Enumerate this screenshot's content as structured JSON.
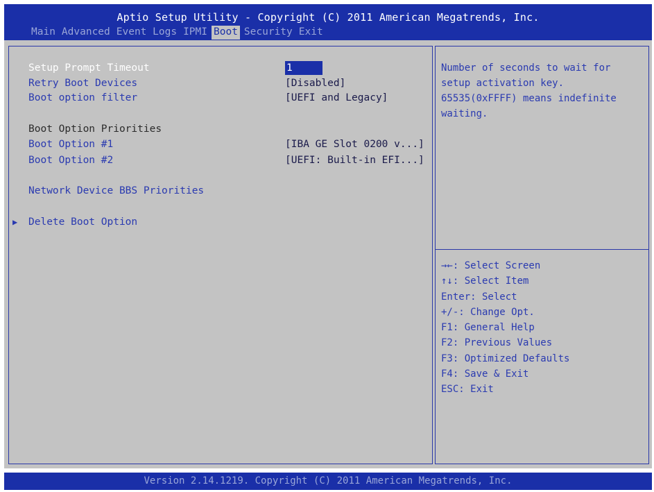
{
  "header": {
    "title": "Aptio Setup Utility - Copyright (C) 2011 American Megatrends, Inc.",
    "tabs": [
      {
        "label": "Main"
      },
      {
        "label": "Advanced"
      },
      {
        "label": "Event Logs"
      },
      {
        "label": "IPMI"
      },
      {
        "label": "Boot",
        "active": true
      },
      {
        "label": "Security"
      },
      {
        "label": "Exit"
      }
    ]
  },
  "settings": {
    "setup_prompt_timeout": {
      "label": "Setup Prompt Timeout",
      "value": "1"
    },
    "retry_boot_devices": {
      "label": "Retry Boot Devices",
      "value": "[Disabled]"
    },
    "boot_option_filter": {
      "label": "Boot option filter",
      "value": "[UEFI and Legacy]"
    },
    "boot_option_priorities": {
      "label": "Boot Option Priorities"
    },
    "boot_option_1": {
      "label": "Boot Option #1",
      "value": "[IBA GE Slot 0200 v...]"
    },
    "boot_option_2": {
      "label": "Boot Option #2",
      "value": "[UEFI: Built-in EFI...]"
    },
    "network_bbs": {
      "label": "Network Device BBS Priorities"
    },
    "delete_boot_option": {
      "label": "Delete Boot Option"
    }
  },
  "help": {
    "lines": [
      "Number of seconds to wait for",
      "setup activation key.",
      "65535(0xFFFF) means indefinite",
      "waiting."
    ]
  },
  "keys": [
    "→←: Select Screen",
    "↑↓: Select Item",
    "Enter: Select",
    "+/-: Change Opt.",
    "F1: General Help",
    "F2: Previous Values",
    "F3: Optimized Defaults",
    "F4: Save & Exit",
    "ESC: Exit"
  ],
  "footer": {
    "text": "Version 2.14.1219. Copyright (C) 2011 American Megatrends, Inc."
  },
  "colors": {
    "header_bg": "#1a2fa8",
    "panel_bg": "#c3c3c3",
    "accent": "#2a3ab0"
  }
}
